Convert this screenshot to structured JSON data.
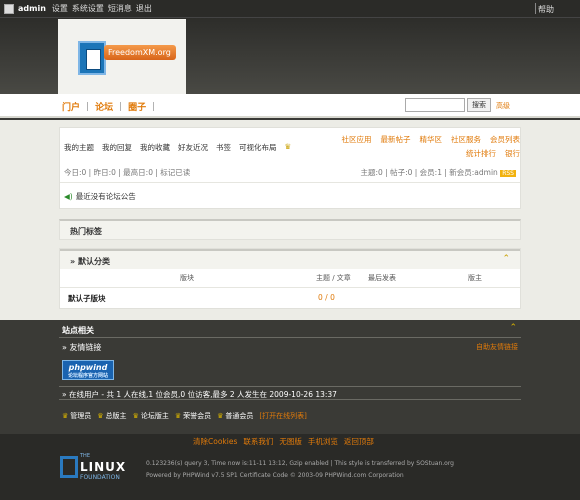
{
  "topbar": {
    "username": "admin",
    "links": [
      "设置",
      "系统设置",
      "短消息",
      "退出"
    ],
    "help": "帮助"
  },
  "logo": {
    "text": "FreedomXM.org"
  },
  "nav": {
    "tabs": [
      "门户",
      "论坛",
      "圈子"
    ],
    "search_button": "搜索",
    "advanced": "高级"
  },
  "user_panel": {
    "links": [
      "我的主题",
      "我的回复",
      "我的收藏",
      "好友近况",
      "书签",
      "可视化布局"
    ],
    "right_links": [
      "社区应用",
      "最新帖子",
      "精华区",
      "社区服务",
      "会员列表",
      "统计排行",
      "银行"
    ],
    "stats_left": "今日:0 | 昨日:0 | 最高日:0 | 标记已读",
    "stats_right": "主题:0 | 帖子:0 | 会员:1 | 新会员:admin",
    "new_badge": "RSS",
    "notice": "最近没有论坛公告"
  },
  "hot_tags": {
    "title": "热门标签"
  },
  "category": {
    "title": "» 默认分类",
    "cols": {
      "forum": "版块",
      "topics": "主题 / 文章",
      "last": "最后发表",
      "mod": "版主"
    },
    "rows": [
      {
        "name": "默认子版块",
        "count": "0 / 0"
      }
    ]
  },
  "footer": {
    "site_title": "站点相关",
    "friend_links": "» 友情链接",
    "friend_links_auto": "自助友情链接",
    "phpwind": {
      "logo": "phpwind",
      "sub": "论坛程序官方网站"
    },
    "online": "» 在线用户 - 共 1 人在线,1 位会员,0 位访客,最多 2 人发生在 2009-10-26 13:37",
    "legend": [
      "管理员",
      "总版主",
      "论坛版主",
      "荣誉会员",
      "普通会员"
    ],
    "open_list": "[打开在线列表]",
    "bottom_links": [
      "清除Cookies",
      "联系我们",
      "无图版",
      "手机浏览",
      "返回顶部"
    ],
    "linux": {
      "the": "THE",
      "name": "LINUX",
      "foundation": "FOUNDATION"
    },
    "line1": "0.123236(s) query 3, Time now is:11-11 13:12, Gzip enabled | This style is transferred by SOStuan.org",
    "line2": "Powered by PHPWind v7.5 SP1 Certificate Code © 2003-09 PHPWind.com Corporation"
  }
}
